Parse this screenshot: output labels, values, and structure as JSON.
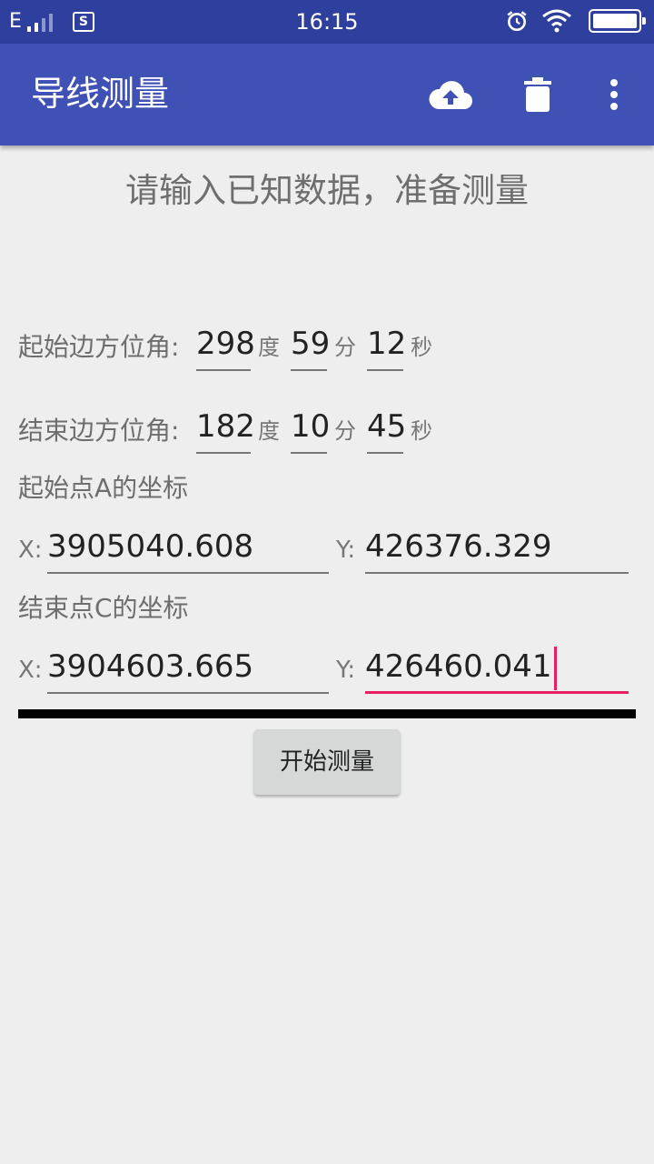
{
  "status": {
    "network": "E",
    "time": "16:15",
    "app_icon_letter": "S"
  },
  "toolbar": {
    "title": "导线测量",
    "icons": [
      "cloud-upload-icon",
      "delete-icon",
      "more-vert-icon"
    ]
  },
  "subtitle": "请输入已知数据，准备测量",
  "start_azimuth": {
    "label": "起始边方位角:",
    "degrees": "298",
    "minutes": "59",
    "seconds": "12"
  },
  "end_azimuth": {
    "label": "结束边方位角:",
    "degrees": "182",
    "minutes": "10",
    "seconds": "45"
  },
  "units": {
    "deg": "度",
    "min": "分",
    "sec": "秒"
  },
  "point_a": {
    "label": "起始点A的坐标",
    "x_label": "X:",
    "x": "3905040.608",
    "y_label": "Y:",
    "y": "426376.329"
  },
  "point_c": {
    "label": "结束点C的坐标",
    "x_label": "X:",
    "x": "3904603.665",
    "y_label": "Y:",
    "y": "426460.041"
  },
  "start_button": "开始测量",
  "colors": {
    "primary": "#3f51b5",
    "primary_dark": "#2f3f9e",
    "accent": "#e91e63",
    "background": "#eeeeee"
  }
}
